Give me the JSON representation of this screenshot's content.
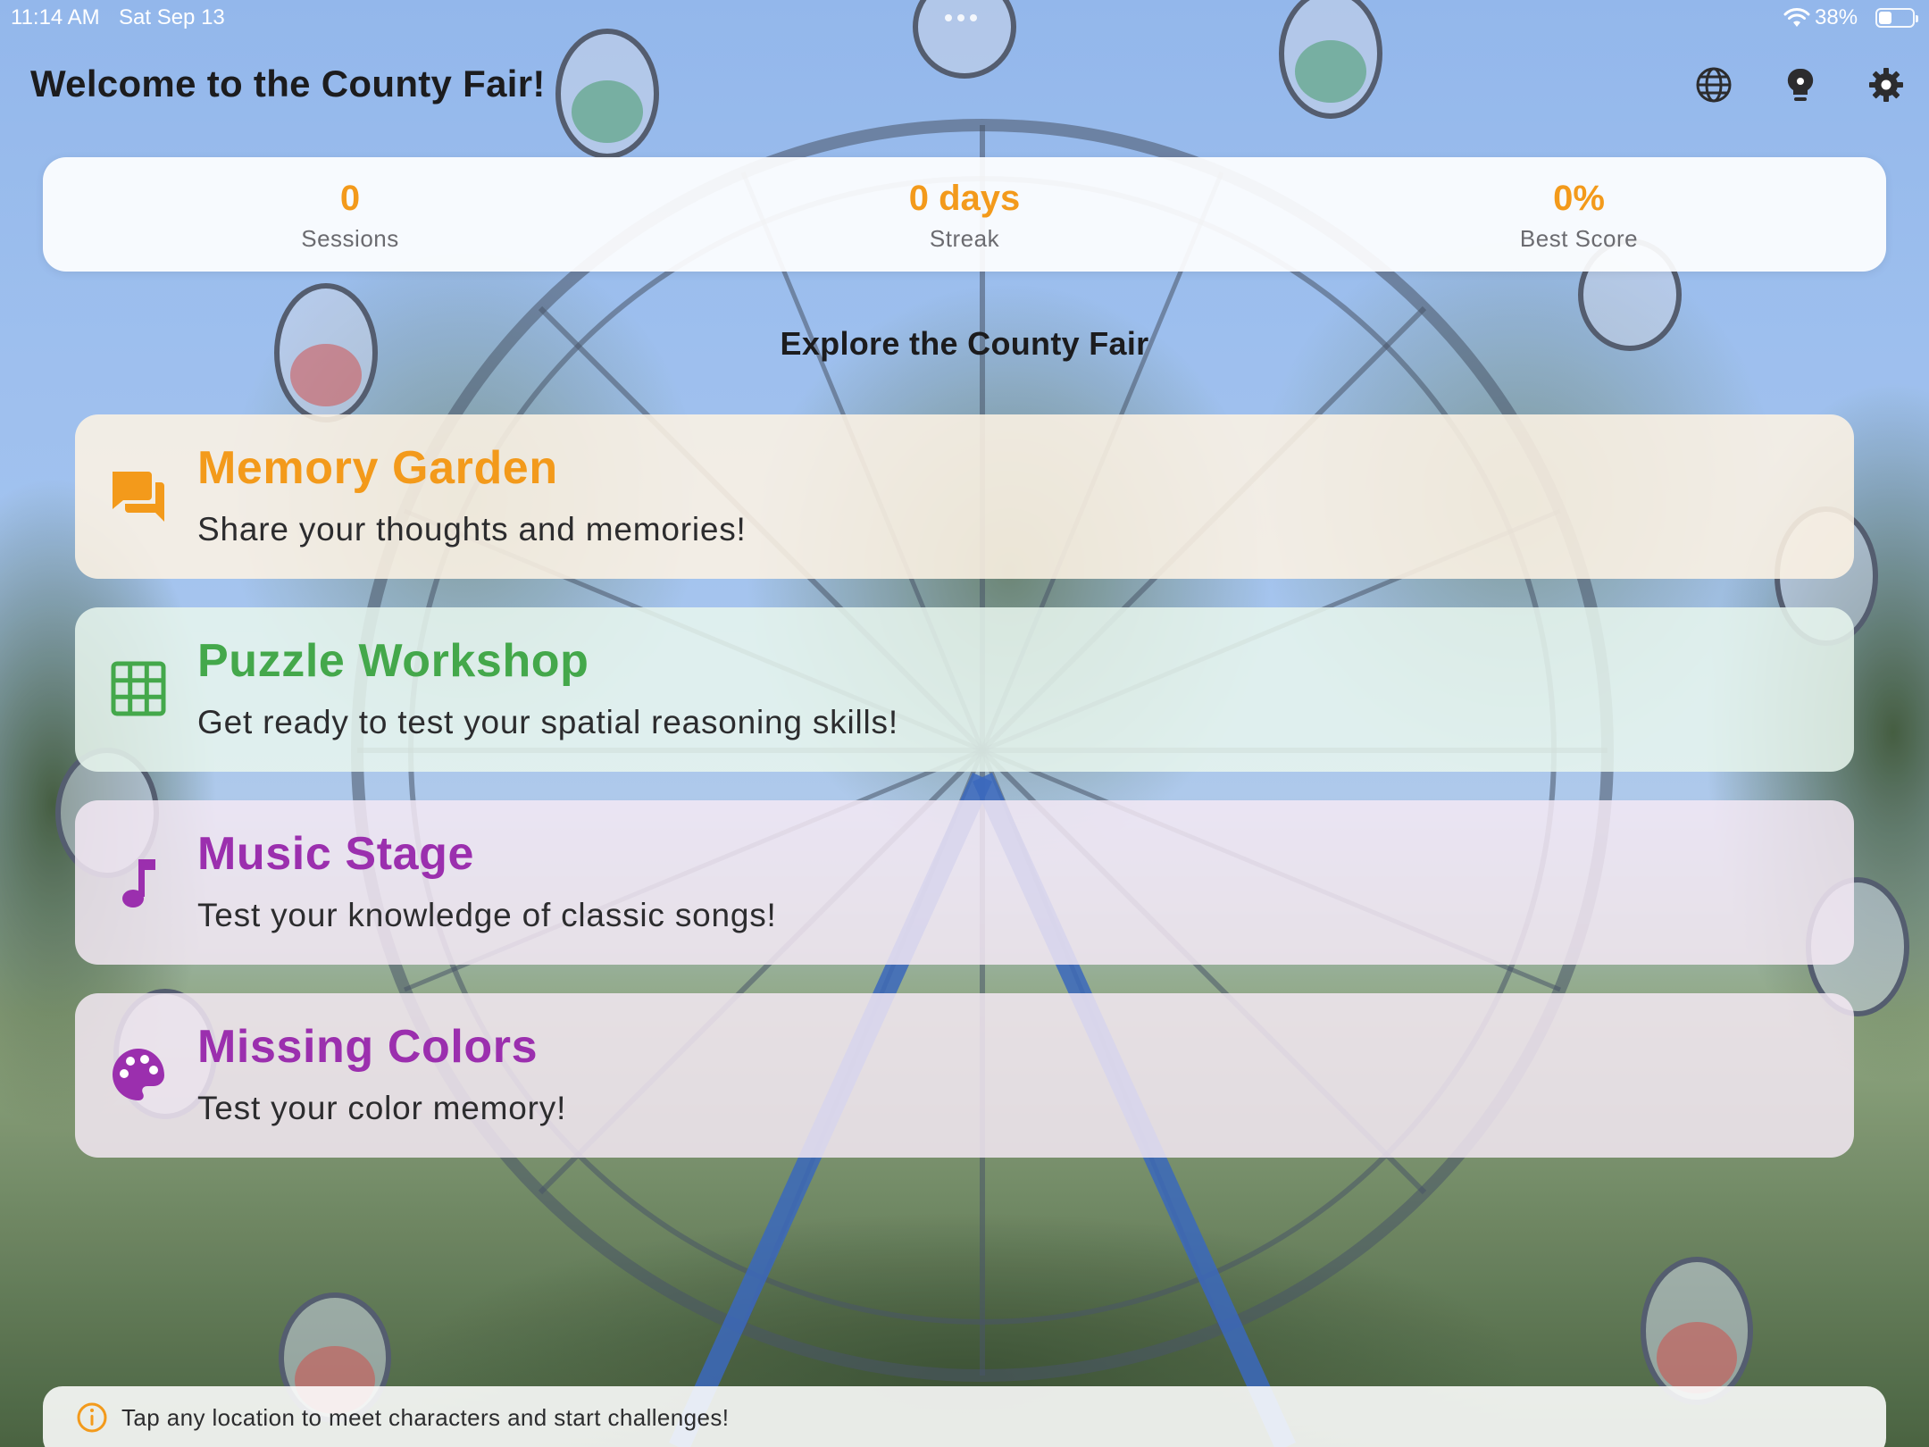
{
  "status_bar": {
    "time": "11:14 AM",
    "date": "Sat Sep 13",
    "battery_percent": "38%"
  },
  "header": {
    "title": "Welcome to the County Fair!",
    "icons": [
      "globe-icon",
      "lightbulb-icon",
      "gear-icon"
    ]
  },
  "stats": [
    {
      "value": "0",
      "label": "Sessions"
    },
    {
      "value": "0 days",
      "label": "Streak"
    },
    {
      "value": "0%",
      "label": "Best Score"
    }
  ],
  "section_title": "Explore the County Fair",
  "activities": [
    {
      "title": "Memory Garden",
      "description": "Share your thoughts and memories!",
      "icon": "chat-bubbles-icon",
      "color": "#f39a1b"
    },
    {
      "title": "Puzzle Workshop",
      "description": "Get ready to test your spatial reasoning skills!",
      "icon": "grid-icon",
      "color": "#44a84b"
    },
    {
      "title": "Music Stage",
      "description": "Test your knowledge of classic songs!",
      "icon": "music-note-icon",
      "color": "#9b2fae"
    },
    {
      "title": "Missing Colors",
      "description": "Test your color memory!",
      "icon": "palette-icon",
      "color": "#9b2fae"
    }
  ],
  "tip": {
    "icon": "info-icon",
    "text": "Tap any location to meet characters and start challenges!"
  },
  "colors": {
    "accent_orange": "#f39a1b",
    "accent_green": "#44a84b",
    "accent_purple": "#9b2fae"
  }
}
